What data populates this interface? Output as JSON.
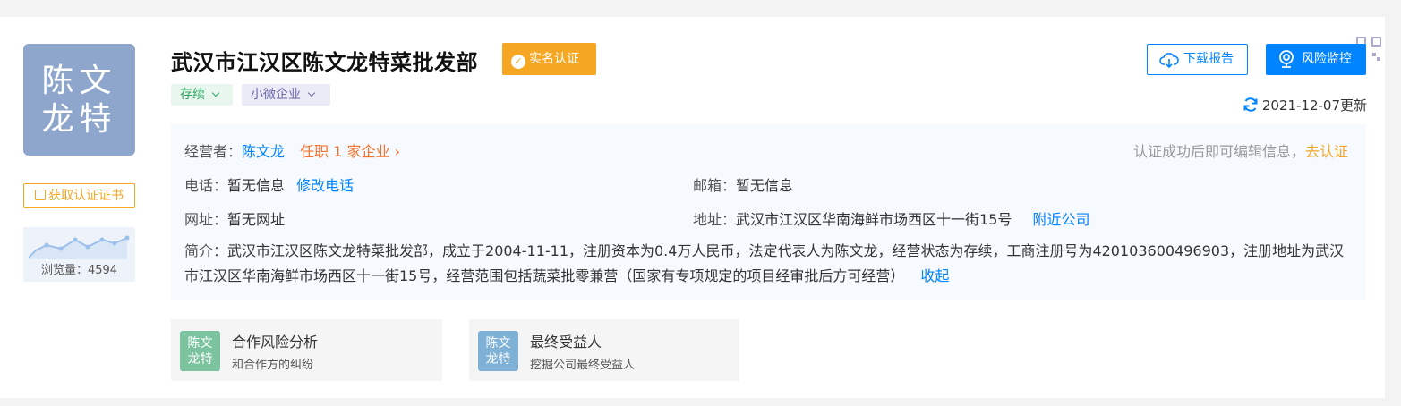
{
  "company": {
    "logo_line1": "陈文",
    "logo_line2": "龙特",
    "name": "武汉市江汉区陈文龙特菜批发部",
    "verified_label": "实名认证",
    "status_tag": "存续",
    "size_tag": "小微企业",
    "cert_button": "获取认证证书",
    "views_label": "浏览量：4594"
  },
  "actions": {
    "download_report": "下载报告",
    "risk_monitor": "风险监控",
    "updated": "2021-12-07更新"
  },
  "info": {
    "operator_label": "经营者：",
    "operator_name": "陈文龙",
    "operator_roles": "任职 1 家企业",
    "verify_hint": "认证成功后即可编辑信息，",
    "verify_link": "去认证",
    "phone_label": "电话：",
    "phone_value": "暂无信息",
    "phone_edit": "修改电话",
    "email_label": "邮箱：",
    "email_value": "暂无信息",
    "website_label": "网址：",
    "website_value": "暂无网址",
    "address_label": "地址：",
    "address_value": "武汉市江汉区华南海鲜市场西区十一街15号",
    "address_nearby": "附近公司",
    "intro_label": "简介：",
    "intro_text": "武汉市江汉区陈文龙特菜批发部，成立于2004-11-11，注册资本为0.4万人民币，法定代表人为陈文龙，经营状态为存续，工商注册号为420103600496903，注册地址为武汉市江汉区华南海鲜市场西区十一街15号，经营范围包括蔬菜批零兼营（国家有专项规定的项目经审批后方可经营）",
    "intro_collapse": "收起"
  },
  "cards": [
    {
      "avatar_line1": "陈文",
      "avatar_line2": "龙特",
      "title": "合作风险分析",
      "subtitle": "和合作方的纠纷",
      "color": "#7cc4a0"
    },
    {
      "avatar_line1": "陈文",
      "avatar_line2": "龙特",
      "title": "最终受益人",
      "subtitle": "挖掘公司最终受益人",
      "color": "#7fb0d6"
    }
  ],
  "icons": [
    "qr-code-icon",
    "check-badge-icon",
    "cloud-download-icon",
    "camera-monitor-icon",
    "refresh-icon",
    "certificate-icon",
    "chevron-right-icon",
    "chevron-down-icon"
  ],
  "colors": {
    "brand": "#0084ff",
    "gold": "#f5a623",
    "orange": "#f5722a",
    "logo": "#8fa6cc"
  }
}
